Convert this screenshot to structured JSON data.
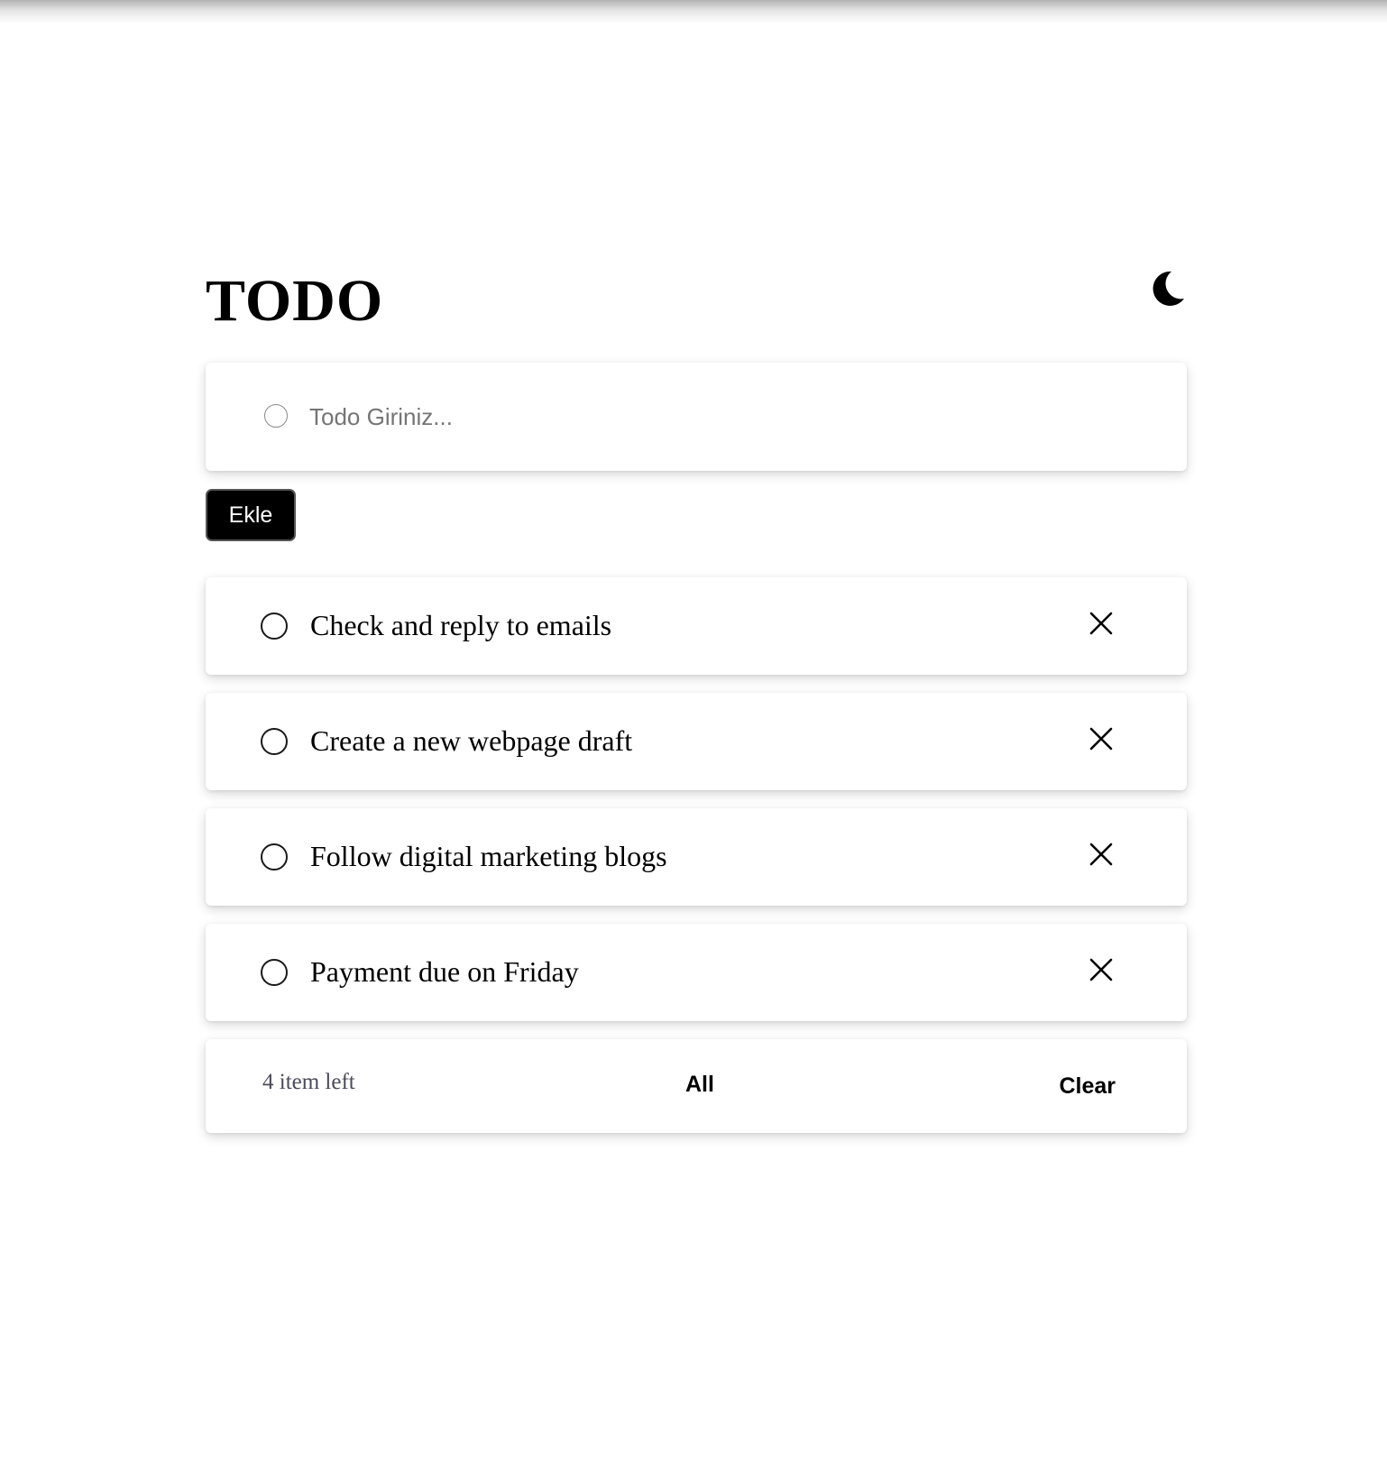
{
  "header": {
    "title": "TODO",
    "theme_icon": "moon-icon"
  },
  "new_todo": {
    "placeholder": "Todo Giriniz...",
    "value": ""
  },
  "add_button": {
    "label": "Ekle"
  },
  "todos": [
    {
      "text": "Check and reply to emails",
      "completed": false
    },
    {
      "text": "Create a new webpage draft",
      "completed": false
    },
    {
      "text": "Follow digital marketing blogs",
      "completed": false
    },
    {
      "text": "Payment due on Friday",
      "completed": false
    }
  ],
  "footer": {
    "items_left": "4 item left",
    "filter_label": "All",
    "clear_label": "Clear"
  },
  "colors": {
    "background": "#ffffff",
    "text": "#000000",
    "button_bg": "#000000",
    "button_text": "#ffffff",
    "muted_text": "#4a4a5a",
    "placeholder": "#757575"
  },
  "icons": {
    "delete": "close-icon",
    "check": "circle-checkbox-icon"
  }
}
